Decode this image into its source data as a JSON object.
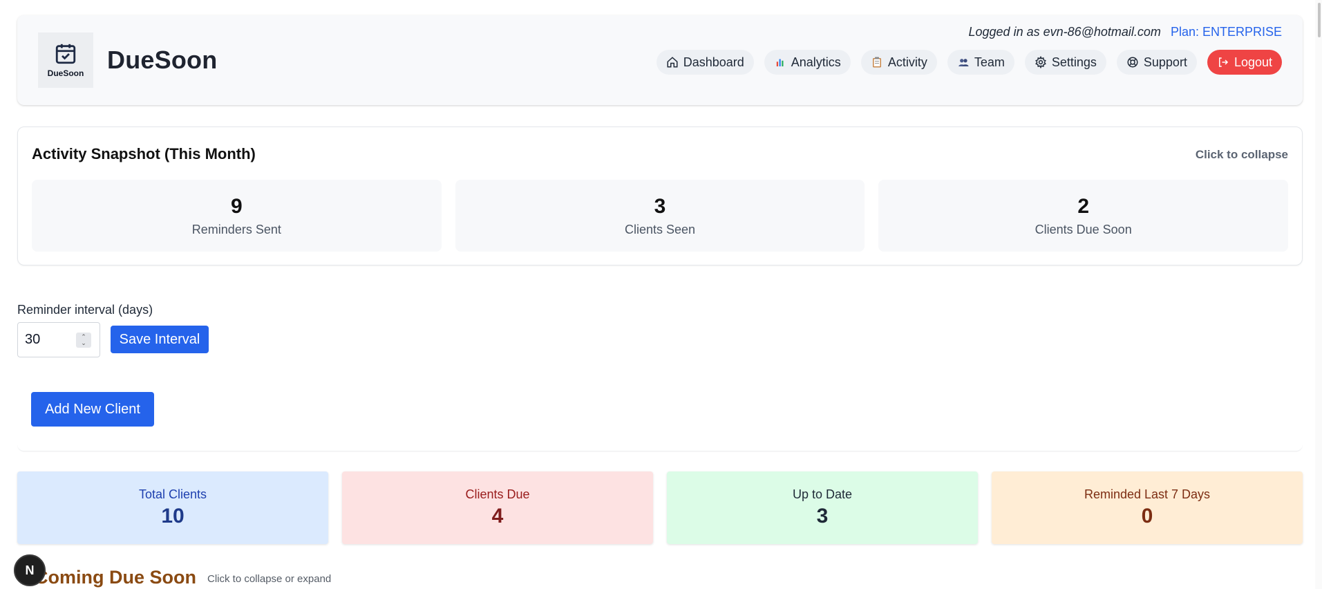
{
  "app": {
    "logo_text": "DueSoon",
    "brand": "DueSoon"
  },
  "header": {
    "logged_in": "Logged in as evn-86@hotmail.com",
    "plan": "Plan: ENTERPRISE",
    "nav": [
      {
        "label": "Dashboard",
        "icon": "home-icon"
      },
      {
        "label": "Analytics",
        "icon": "bar-chart-icon"
      },
      {
        "label": "Activity",
        "icon": "clipboard-icon"
      },
      {
        "label": "Team",
        "icon": "people-icon"
      },
      {
        "label": "Settings",
        "icon": "gear-icon"
      },
      {
        "label": "Support",
        "icon": "lifebuoy-icon"
      },
      {
        "label": "Logout",
        "icon": "logout-icon"
      }
    ]
  },
  "snapshot": {
    "title": "Activity Snapshot (This Month)",
    "collapse": "Click to collapse",
    "cards": [
      {
        "value": "9",
        "label": "Reminders Sent"
      },
      {
        "value": "3",
        "label": "Clients Seen"
      },
      {
        "value": "2",
        "label": "Clients Due Soon"
      }
    ]
  },
  "interval": {
    "label": "Reminder interval (days)",
    "value": "30",
    "save_label": "Save Interval"
  },
  "add_client": {
    "label": "Add New Client"
  },
  "stats": [
    {
      "label": "Total Clients",
      "value": "10",
      "color": "#dbeafe"
    },
    {
      "label": "Clients Due",
      "value": "4",
      "color": "#fde2e2"
    },
    {
      "label": "Up to Date",
      "value": "3",
      "color": "#dcfce7"
    },
    {
      "label": "Reminded Last 7 Days",
      "value": "0",
      "color": "#ffedd5"
    }
  ],
  "upcoming": {
    "title": "Coming Due Soon",
    "hint": "Click to collapse or expand"
  },
  "badge": {
    "letter": "N"
  }
}
